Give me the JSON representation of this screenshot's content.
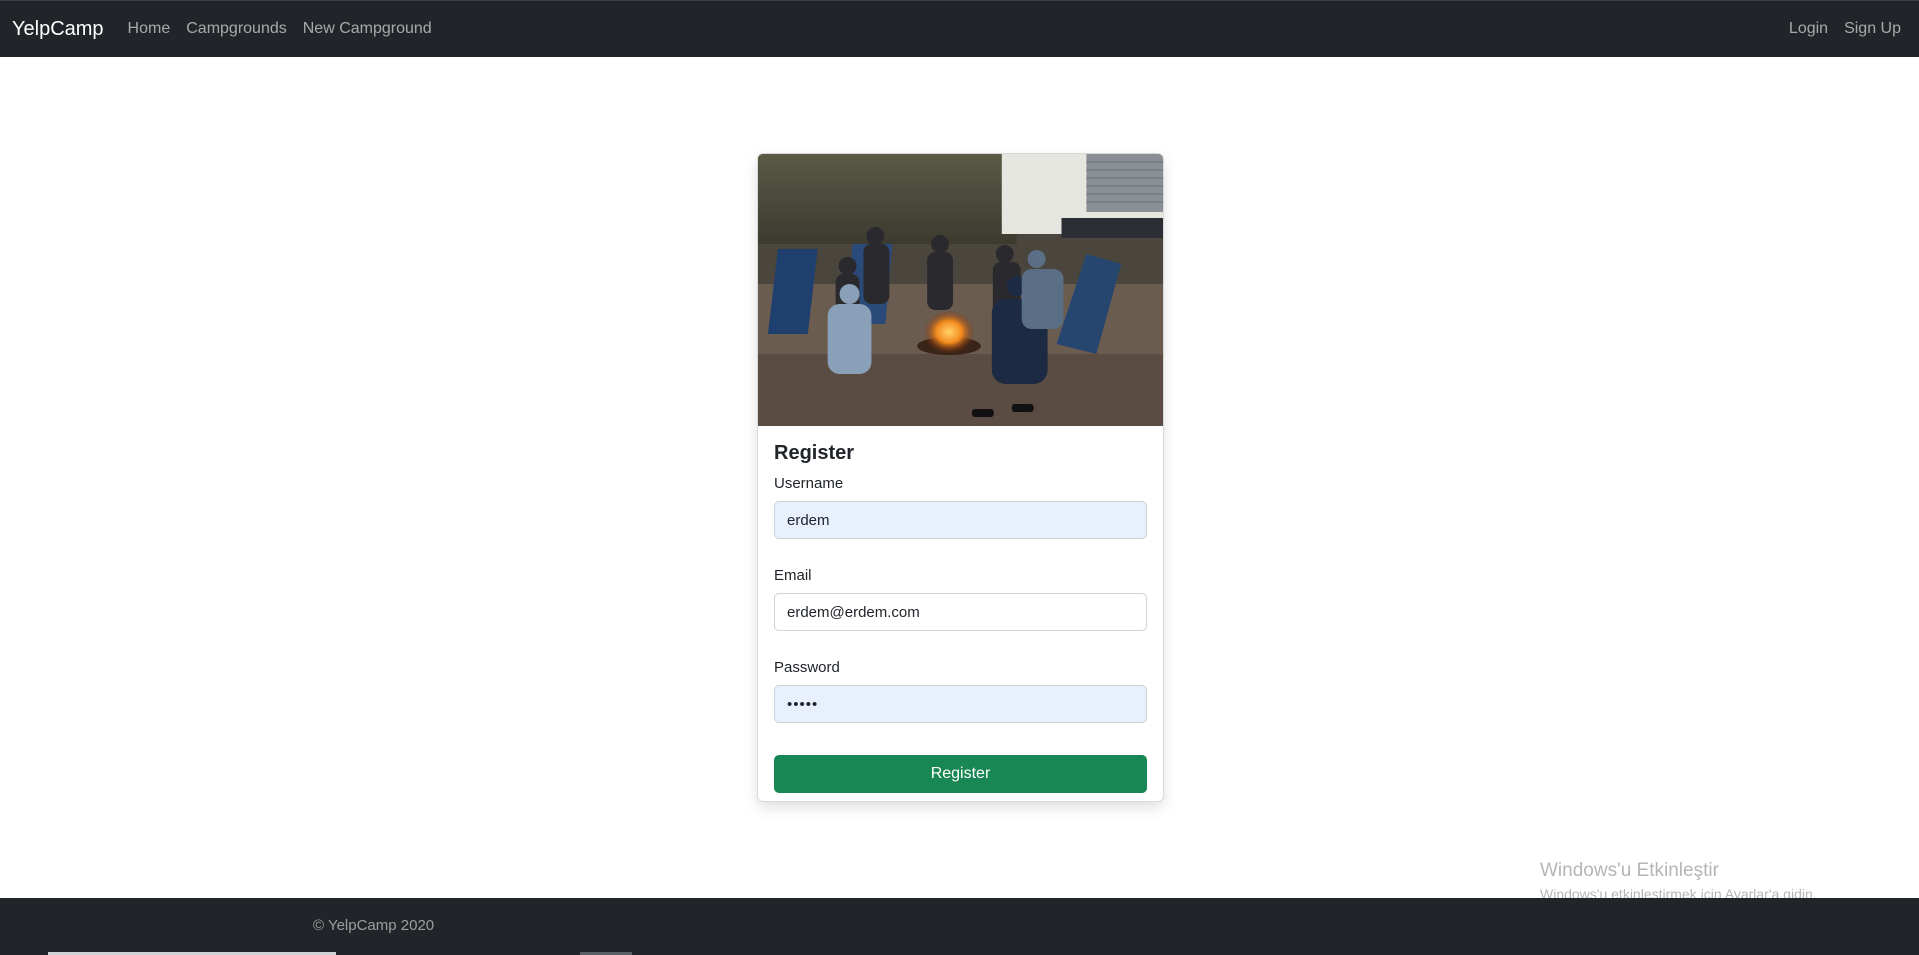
{
  "navbar": {
    "brand": "YelpCamp",
    "links": [
      {
        "label": "Home"
      },
      {
        "label": "Campgrounds"
      },
      {
        "label": "New Campground"
      }
    ],
    "auth_links": [
      {
        "label": "Login"
      },
      {
        "label": "Sign Up"
      }
    ]
  },
  "card": {
    "title": "Register",
    "fields": {
      "username": {
        "label": "Username",
        "value": "erdem"
      },
      "email": {
        "label": "Email",
        "value": "erdem@erdem.com"
      },
      "password": {
        "label": "Password",
        "value": "•••••"
      }
    },
    "submit_label": "Register"
  },
  "footer": {
    "copyright": "© YelpCamp 2020"
  },
  "watermark": {
    "title": "Windows'u Etkinleştir",
    "subtitle": "Windows'u etkinleştirmek için Ayarlar'a gidin."
  },
  "colors": {
    "navbar_bg": "#212529",
    "button_success": "#198754",
    "autofill_bg": "#e8f0fe"
  }
}
